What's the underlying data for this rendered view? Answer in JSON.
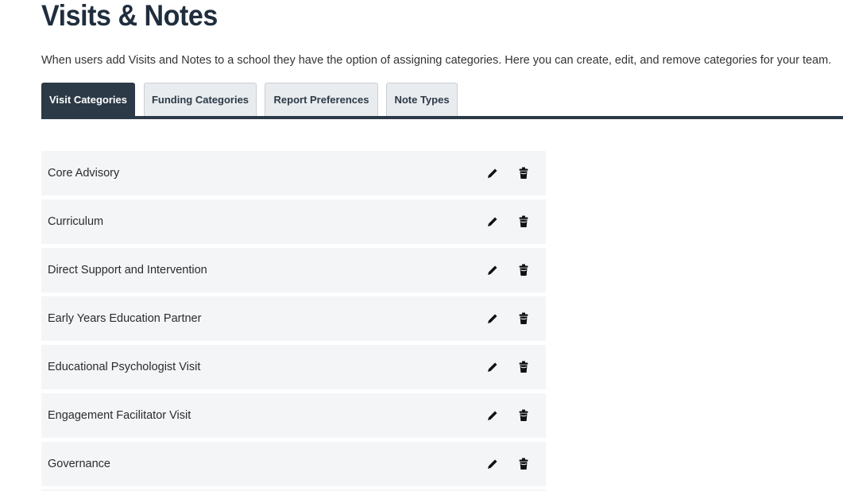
{
  "header": {
    "title": "Visits & Notes",
    "description": "When users add Visits and Notes to a school they have the option of assigning categories. Here you can create, edit, and remove categories for your team."
  },
  "tabs": [
    {
      "label": "Visit Categories",
      "active": true
    },
    {
      "label": "Funding Categories",
      "active": false
    },
    {
      "label": "Report Preferences",
      "active": false
    },
    {
      "label": "Note Types",
      "active": false
    }
  ],
  "categories": [
    {
      "label": "Core Advisory",
      "edit_icon": "pencil-icon",
      "delete_icon": "trash-icon"
    },
    {
      "label": "Curriculum",
      "edit_icon": "pencil-icon",
      "delete_icon": "trash-icon"
    },
    {
      "label": "Direct Support and Intervention",
      "edit_icon": "pencil-icon",
      "delete_icon": "trash-icon"
    },
    {
      "label": "Early Years Education Partner",
      "edit_icon": "pencil-icon",
      "delete_icon": "trash-icon"
    },
    {
      "label": "Educational Psychologist Visit",
      "edit_icon": "pencil-icon",
      "delete_icon": "trash-icon"
    },
    {
      "label": "Engagement Facilitator Visit",
      "edit_icon": "pencil-icon",
      "delete_icon": "trash-icon"
    },
    {
      "label": "Governance",
      "edit_icon": "pencil-icon",
      "delete_icon": "trash-icon"
    }
  ],
  "colors": {
    "title": "#1f2d3d",
    "tab_active_bg": "#2c3a47",
    "tab_inactive_bg": "#e9ecef",
    "row_bg": "#f4f5f7"
  }
}
